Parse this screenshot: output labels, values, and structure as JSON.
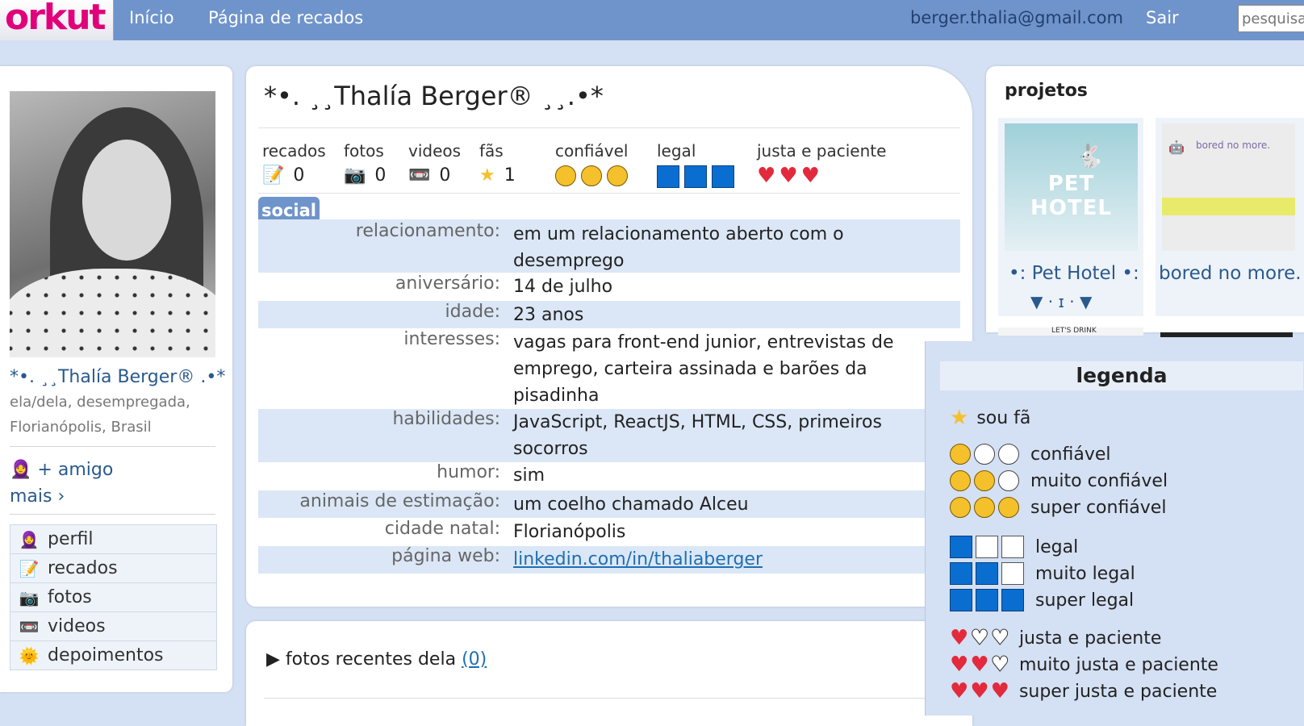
{
  "topbar": {
    "logo": "orkut",
    "nav": [
      "Início",
      "Página de recados"
    ],
    "email": "berger.thalia@gmail.com",
    "logout": "Sair",
    "search_placeholder": "pesquisa"
  },
  "profile": {
    "name": "*•. ¸¸Thalía Berger® .•*",
    "pronouns_status": "ela/dela, desempregada,",
    "location": "Florianópolis, Brasil",
    "add_friend": "+ amigo",
    "more": "mais ›",
    "menu": [
      {
        "icon": "🧕",
        "label": "perfil"
      },
      {
        "icon": "📝",
        "label": "recados"
      },
      {
        "icon": "📷",
        "label": "fotos"
      },
      {
        "icon": "📼",
        "label": "videos"
      },
      {
        "icon": "🌞",
        "label": "depoimentos"
      }
    ]
  },
  "main": {
    "title": "*•. ¸¸Thalía Berger® ¸¸.•*",
    "stats": {
      "recados": {
        "label": "recados",
        "value": "0"
      },
      "fotos": {
        "label": "fotos",
        "value": "0"
      },
      "videos": {
        "label": "videos",
        "value": "0"
      },
      "fas": {
        "label": "fãs",
        "value": "1"
      },
      "confiavel": {
        "label": "confiável",
        "level": 3
      },
      "legal": {
        "label": "legal",
        "level": 3
      },
      "justa": {
        "label": "justa e paciente",
        "level": 3
      }
    },
    "social_tab": "social",
    "info": [
      {
        "key": "relacionamento:",
        "value": "em um relacionamento aberto com o desemprego"
      },
      {
        "key": "aniversário:",
        "value": "14 de julho"
      },
      {
        "key": "idade:",
        "value": "23 anos"
      },
      {
        "key": "interesses:",
        "value": "vagas para front-end junior, entrevistas de emprego, carteira assinada e barões da pisadinha"
      },
      {
        "key": "habilidades:",
        "value": "JavaScript, ReactJS, HTML, CSS, primeiros socorros"
      },
      {
        "key": "humor:",
        "value": "sim"
      },
      {
        "key": "animais de estimação:",
        "value": "um coelho chamado Alceu"
      },
      {
        "key": "cidade natal:",
        "value": "Florianópolis"
      },
      {
        "key": "página web:",
        "value": "linkedin.com/in/thaliaberger"
      }
    ],
    "recent_photos": {
      "label": "fotos recentes dela",
      "count": "(0)"
    }
  },
  "projects": {
    "title": "projetos",
    "items": [
      {
        "image_text": "PET HOTEL",
        "name_line1": "•: Pet Hotel •:",
        "name_line2": "▼ · ɪ · ▼"
      },
      {
        "image_text": "bored no more.",
        "name_line1": "bored no more."
      }
    ],
    "thumb_labels": [
      "LET'S DRINK"
    ]
  },
  "legend": {
    "title": "legenda",
    "fan": "sou fã",
    "confiavel": [
      "confiável",
      "muito confiável",
      "super confiável"
    ],
    "legal": [
      "legal",
      "muito legal",
      "super legal"
    ],
    "justa": [
      "justa e paciente",
      "muito justa e paciente",
      "super justa e paciente"
    ]
  },
  "colors": {
    "topbar": "#6f94cb",
    "page_bg": "#d4e0f3",
    "logo": "#e2007a",
    "link": "#2a5a8c",
    "row_alt": "#dbe7f6"
  }
}
